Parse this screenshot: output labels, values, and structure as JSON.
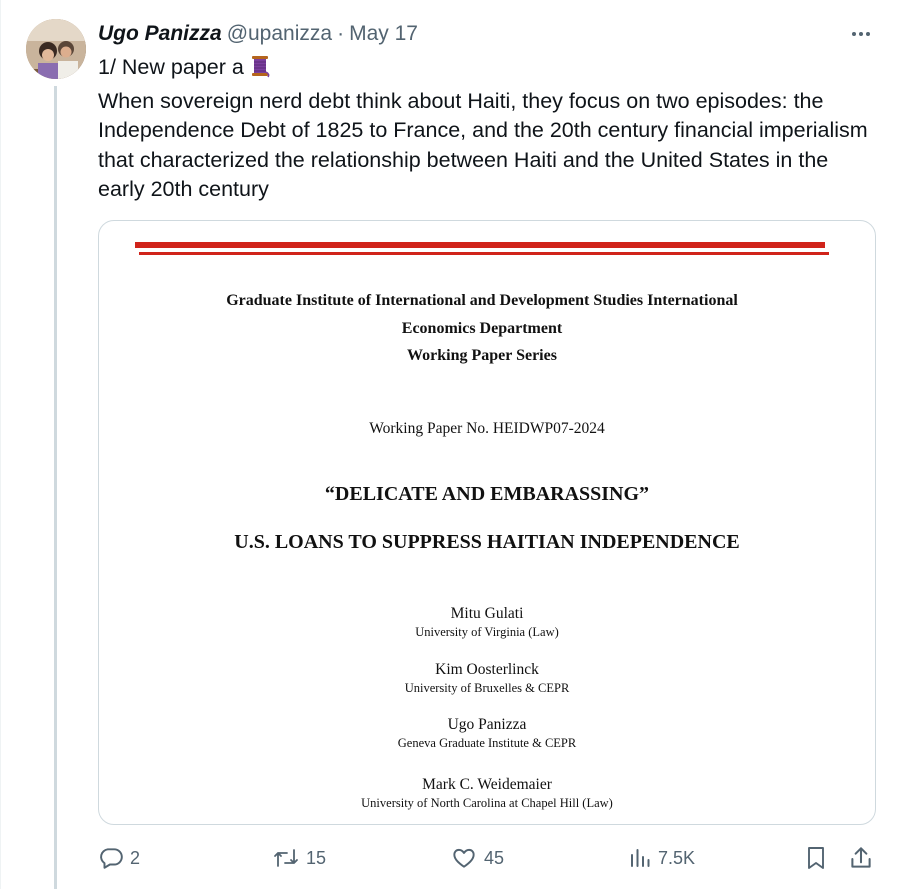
{
  "tweet": {
    "display_name": "Ugo Panizza",
    "handle": "@upanizza",
    "separator": "·",
    "date": "May 17",
    "text_line1": "1/ New paper a",
    "text_body": "When sovereign nerd debt think about Haiti, they focus on two episodes: the Independence Debt of 1825 to France, and the 20th century financial imperialism that characterized the relationship between Haiti and the United States in the early 20th century",
    "emoji_icon": "thread-spool-icon"
  },
  "paper": {
    "institute_lines": [
      "Graduate Institute of International and Development Studies International",
      "Economics Department",
      "Working Paper Series"
    ],
    "working_paper_no": "Working Paper No. HEIDWP07-2024",
    "title_line1": "“DELICATE AND EMBARASSING”",
    "title_line2": "U.S. LOANS TO SUPPRESS HAITIAN INDEPENDENCE",
    "authors": [
      {
        "name": "Mitu Gulati",
        "affiliation": "University of Virginia (Law)"
      },
      {
        "name": "Kim Oosterlinck",
        "affiliation": "University of Bruxelles & CEPR"
      },
      {
        "name": "Ugo Panizza",
        "affiliation": "Geneva Graduate Institute & CEPR"
      },
      {
        "name": "Mark C. Weidemaier",
        "affiliation": "University of North Carolina at Chapel Hill (Law)"
      }
    ],
    "accent_color": "#d0231a"
  },
  "actions": {
    "replies": "2",
    "reposts": "15",
    "likes": "45",
    "views": "7.5K"
  },
  "colors": {
    "text": "#0f1419",
    "secondary": "#536471",
    "border": "#cfd9de"
  }
}
